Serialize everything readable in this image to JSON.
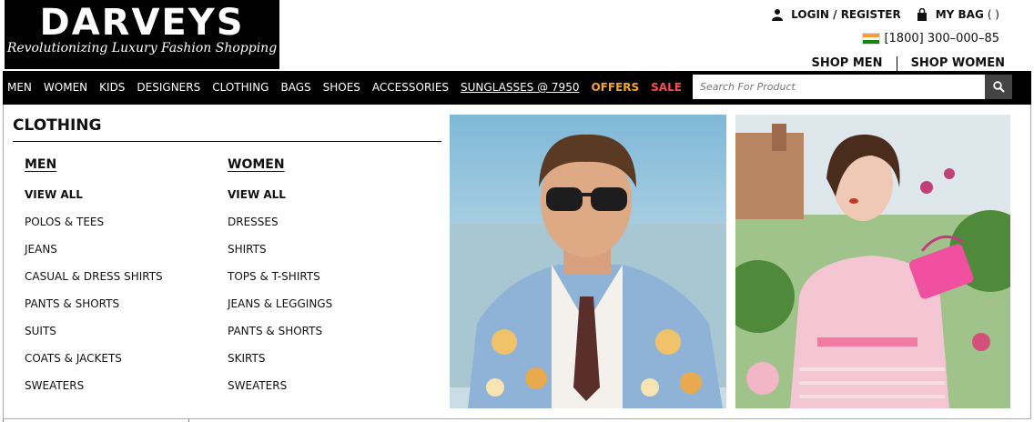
{
  "brand": {
    "name": "DARVEYS",
    "tagline": "Revolutionizing Luxury Fashion Shopping"
  },
  "header": {
    "login_label": "LOGIN / REGISTER",
    "bag_label": "MY BAG",
    "bag_count": "( )",
    "phone": "[1800] 300–000–85",
    "shop_men": "SHOP MEN",
    "shop_women": "SHOP WOMEN"
  },
  "nav": {
    "items": [
      "MEN",
      "WOMEN",
      "KIDS",
      "DESIGNERS",
      "CLOTHING",
      "BAGS",
      "SHOES",
      "ACCESSORIES"
    ],
    "sunglasses": "SUNGLASSES @ 7950",
    "offers": "OFFERS",
    "sale": "SALE",
    "colors": {
      "offers": "#f5a623",
      "sale": "#ff4b4b"
    }
  },
  "search": {
    "placeholder": "Search For Product",
    "icon": "search-icon"
  },
  "menu": {
    "title": "CLOTHING",
    "men": {
      "heading": "MEN",
      "items": [
        "VIEW ALL",
        "POLOS & TEES",
        "JEANS",
        "CASUAL & DRESS SHIRTS",
        "PANTS & SHORTS",
        "SUITS",
        "COATS & JACKETS",
        "SWEATERS"
      ]
    },
    "women": {
      "heading": "WOMEN",
      "items": [
        "VIEW ALL",
        "DRESSES",
        "SHIRTS",
        "TOPS & T-SHIRTS",
        "JEANS & LEGGINGS",
        "PANTS & SHORTS",
        "SKIRTS",
        "SWEATERS"
      ]
    }
  }
}
